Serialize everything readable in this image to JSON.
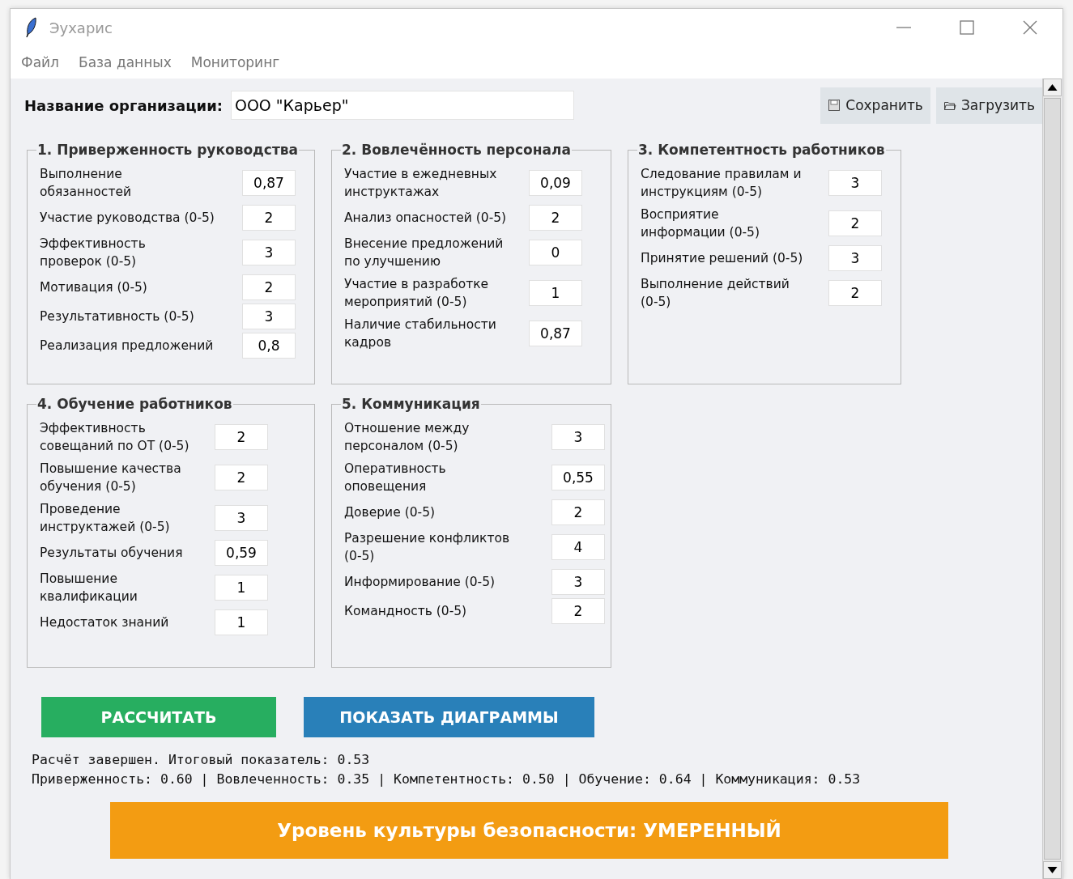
{
  "window": {
    "title": "Эухарис"
  },
  "menu": [
    "Файл",
    "База данных",
    "Мониторинг"
  ],
  "organization": {
    "label": "Название организации:",
    "value": "ООО \"Карьер\""
  },
  "toolbar": [
    {
      "kind": "save",
      "label": "Сохранить"
    },
    {
      "kind": "load",
      "label": "Загрузить"
    }
  ],
  "groups": [
    {
      "title": "1. Приверженность руководства",
      "fields": [
        {
          "label": "Выполнение\nобязанностей",
          "value": "0,87"
        },
        {
          "label": "Участие руководства (0-5)",
          "value": "2"
        },
        {
          "label": "Эффективность\nпроверок (0-5)",
          "value": "3"
        },
        {
          "label": "Мотивация (0-5)",
          "value": "2"
        },
        {
          "label": "Результативность (0-5)",
          "value": "3"
        },
        {
          "label": "Реализация предложений",
          "value": "0,8"
        }
      ]
    },
    {
      "title": "2. Вовлечённость персонала",
      "fields": [
        {
          "label": "Участие в ежедневных\nинструктажах",
          "value": "0,09"
        },
        {
          "label": "Анализ опасностей (0-5)",
          "value": "2"
        },
        {
          "label": "Внесение предложений\nпо улучшению",
          "value": "0"
        },
        {
          "label": "Участие в разработке\nмероприятий (0-5)",
          "value": "1"
        },
        {
          "label": "Наличие стабильности\nкадров",
          "value": "0,87"
        }
      ]
    },
    {
      "title": "3. Компетентность работников",
      "fields": [
        {
          "label": "Следование правилам и\nинструкциям (0-5)",
          "value": "3"
        },
        {
          "label": "Восприятие\nинформации (0-5)",
          "value": "2"
        },
        {
          "label": "Принятие решений (0-5)",
          "value": "3"
        },
        {
          "label": "Выполнение действий\n(0-5)",
          "value": "2"
        }
      ]
    },
    {
      "title": "4. Обучение работников",
      "fields": [
        {
          "label": "Эффективность\nсовещаний по ОТ (0-5)",
          "value": "2"
        },
        {
          "label": "Повышение качества\nобучения (0-5)",
          "value": "2"
        },
        {
          "label": "Проведение\nинструктажей (0-5)",
          "value": "3"
        },
        {
          "label": "Результаты обучения",
          "value": "0,59"
        },
        {
          "label": "Повышение\nквалификации",
          "value": "1"
        },
        {
          "label": "Недостаток знаний",
          "value": "1"
        }
      ]
    },
    {
      "title": "5. Коммуникация",
      "fields": [
        {
          "label": "Отношение между\nперсоналом (0-5)",
          "value": "3"
        },
        {
          "label": "Оперативность\nоповещения",
          "value": "0,55"
        },
        {
          "label": "Доверие (0-5)",
          "value": "2"
        },
        {
          "label": "Разрешение конфликтов\n(0-5)",
          "value": "4"
        },
        {
          "label": "Информирование (0-5)",
          "value": "3"
        },
        {
          "label": "Командность (0-5)",
          "value": "2"
        }
      ]
    }
  ],
  "actions": [
    {
      "label": "РАССЧИТАТЬ",
      "color": "#27ae60"
    },
    {
      "label": "ПОКАЗАТЬ ДИАГРАММЫ",
      "color": "#2980b9"
    }
  ],
  "status_lines": [
    "Расчёт завершен. Итоговый показатель: 0.53",
    "Приверженность: 0.60 | Вовлеченность: 0.35 | Компетентность: 0.50 | Обучение: 0.64 | Коммуникация: 0.53"
  ],
  "result_banner": {
    "text": "Уровень культуры безопасности: УМЕРЕННЫЙ",
    "color": "#f39c12"
  }
}
